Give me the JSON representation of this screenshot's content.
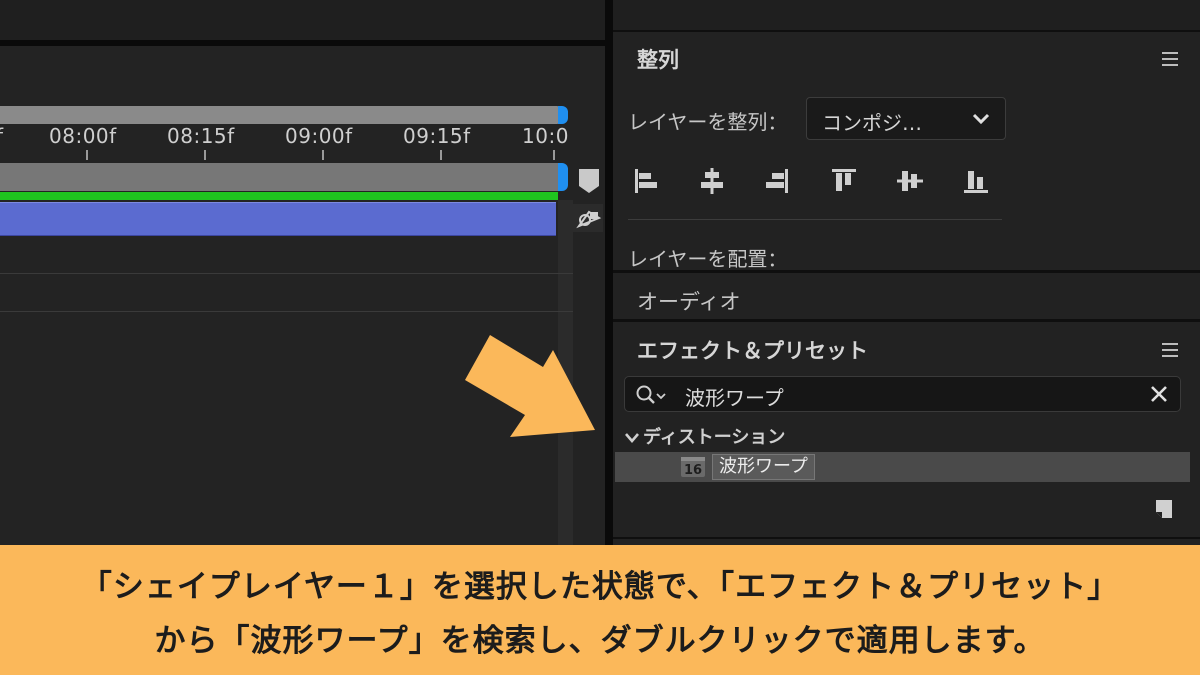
{
  "timeline": {
    "ticks": [
      "f",
      "08:00f",
      "08:15f",
      "09:00f",
      "09:15f",
      "10:0"
    ]
  },
  "align_panel": {
    "title": "整列",
    "align_label": "レイヤーを整列：",
    "align_to_value": "コンポジ…",
    "distribute_label": "レイヤーを配置：",
    "icons": [
      "align-left-icon",
      "align-horizontal-center-icon",
      "align-right-icon",
      "align-top-icon",
      "align-vertical-center-icon",
      "align-bottom-icon"
    ]
  },
  "audio_panel": {
    "title": "オーディオ"
  },
  "effects_panel": {
    "title": "エフェクト＆プリセット",
    "search_value": "波形ワープ",
    "category": "ディストーション",
    "result_badge": "16",
    "result_label": "波形ワープ"
  },
  "colors": {
    "accent_blue": "#1f8ff0",
    "green_bar": "#1fc41f",
    "clip_blue": "#5b6bd0",
    "arrow": "#fbb85a",
    "caption_bg": "#fbb85a"
  },
  "caption": {
    "line1": "「シェイプレイヤー１」を選択した状態で、「エフェクト＆プリセット」",
    "line2": "から「波形ワープ」を検索し、ダブルクリックで適用します。"
  }
}
